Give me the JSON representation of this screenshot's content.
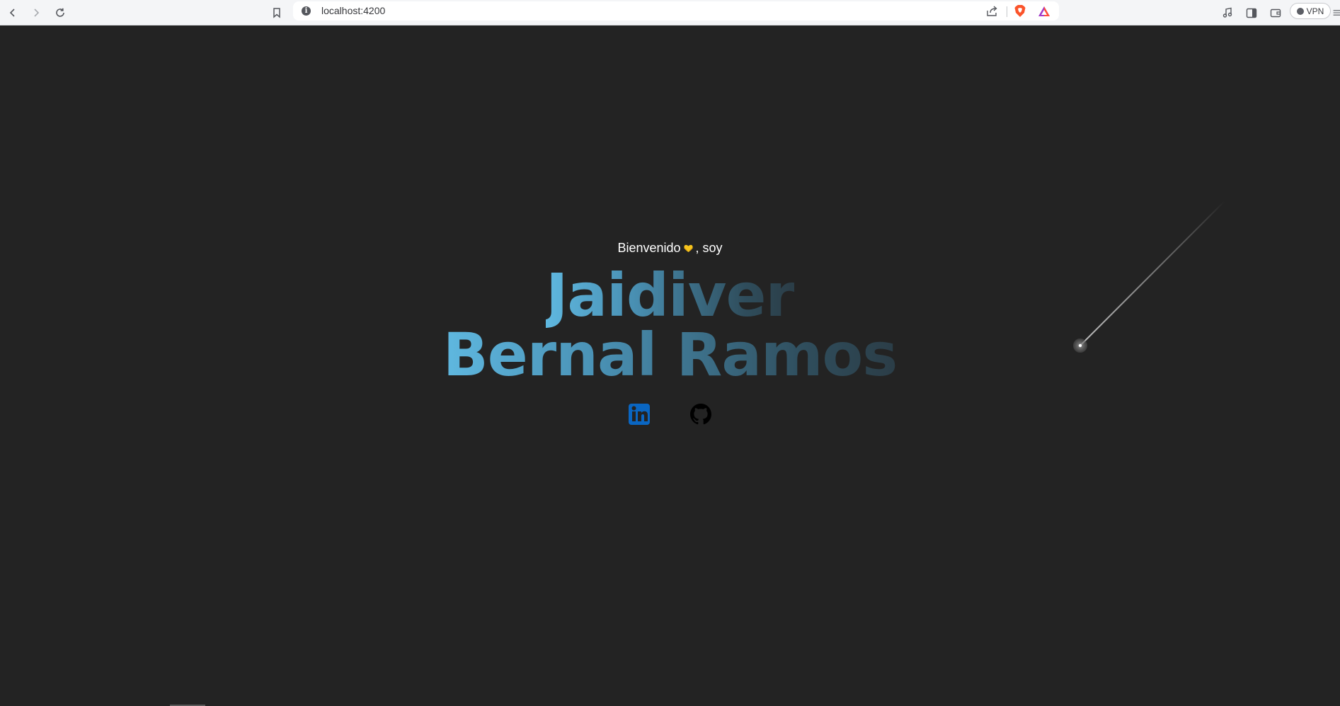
{
  "browser": {
    "url": "localhost:4200",
    "vpn_label": "VPN",
    "icons": [
      "back-icon",
      "forward-icon",
      "reload-icon",
      "bookmark-icon",
      "info-icon",
      "share-icon",
      "brave-shields-icon",
      "brave-rewards-icon",
      "media-icon",
      "sidebar-icon",
      "wallet-icon",
      "menu-icon"
    ]
  },
  "hero": {
    "greeting_before": "Bienvenido",
    "greeting_after": ", soy",
    "emoji": "yellow-heart-hands-emoji",
    "name_line1": "Jaidiver",
    "name_line2": "Bernal Ramos"
  },
  "social": [
    {
      "name": "LinkedIn",
      "icon": "linkedin-icon",
      "color": "#0a66c2"
    },
    {
      "name": "GitHub",
      "icon": "github-icon",
      "color": "#000000"
    }
  ],
  "colors": {
    "background": "#232323",
    "name_gradient_start": "#5fb8e0",
    "name_gradient_end": "#2b3d47"
  }
}
